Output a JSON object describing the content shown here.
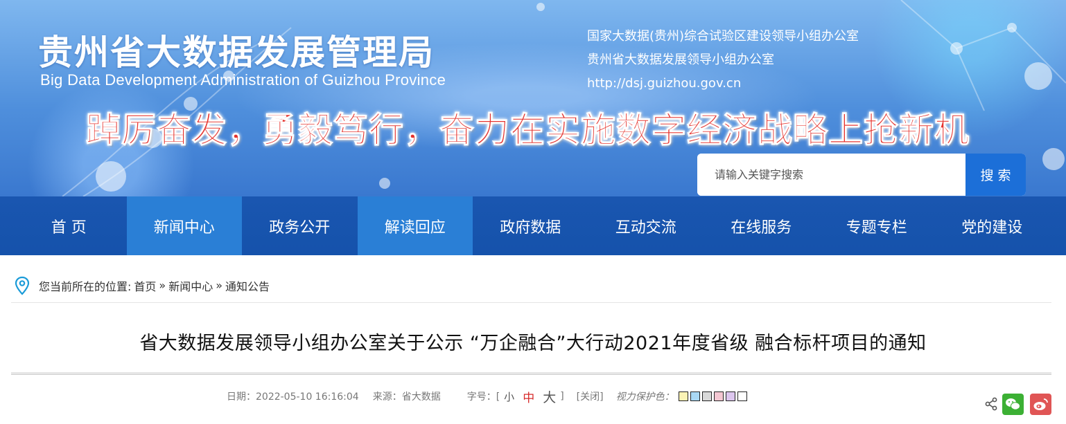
{
  "header": {
    "title": "贵州省大数据发展管理局",
    "subtitle": "Big Data Development Administration of Guizhou Province",
    "info_lines": [
      "国家大数据(贵州)综合试验区建设领导小组办公室",
      "贵州省大数据发展领导小组办公室",
      "http://dsj.guizhou.gov.cn"
    ],
    "slogan": "踔厉奋发，勇毅笃行，奋力在实施数字经济战略上抢新机"
  },
  "search": {
    "placeholder": "请输入关键字搜索",
    "button_label": "搜 索"
  },
  "nav": {
    "items": [
      {
        "label": "首 页",
        "active": false
      },
      {
        "label": "新闻中心",
        "active": true
      },
      {
        "label": "政务公开",
        "active": false
      },
      {
        "label": "解读回应",
        "active": true
      },
      {
        "label": "政府数据",
        "active": false
      },
      {
        "label": "互动交流",
        "active": false
      },
      {
        "label": "在线服务",
        "active": false
      },
      {
        "label": "专题专栏",
        "active": false
      },
      {
        "label": "党的建设",
        "active": false
      }
    ]
  },
  "breadcrumb": {
    "prefix": "您当前所在的位置:",
    "items": [
      "首页",
      "新闻中心",
      "通知公告"
    ],
    "separator": "»"
  },
  "article": {
    "title": "省大数据发展领导小组办公室关于公示 “万企融合”大行动2021年度省级 融合标杆项目的通知",
    "date": "日期：2022-05-10 16:16:04",
    "source": "来源：省大数据",
    "font_size_label": "字号：[",
    "font_sizes": [
      "小",
      "中",
      "大"
    ],
    "font_size_close": "]",
    "close_label": "[关闭]",
    "eye_protect_label": "视力保护色：",
    "eye_colors": [
      "#fbf3b5",
      "#a9d8f4",
      "#d9d9d9",
      "#f4c7d2",
      "#dcc6ee",
      "#ffffff"
    ]
  },
  "colors": {
    "nav_bg": "#1552ab",
    "nav_active": "#2a7fd6",
    "search_button": "#1c6fd8",
    "slogan": "#e5322d",
    "current_font_size": "#d62a2a",
    "wechat": "#3cb034",
    "weibo": "#e05555"
  },
  "share": {
    "icons": [
      "share-icon",
      "wechat-icon",
      "weibo-icon"
    ]
  }
}
